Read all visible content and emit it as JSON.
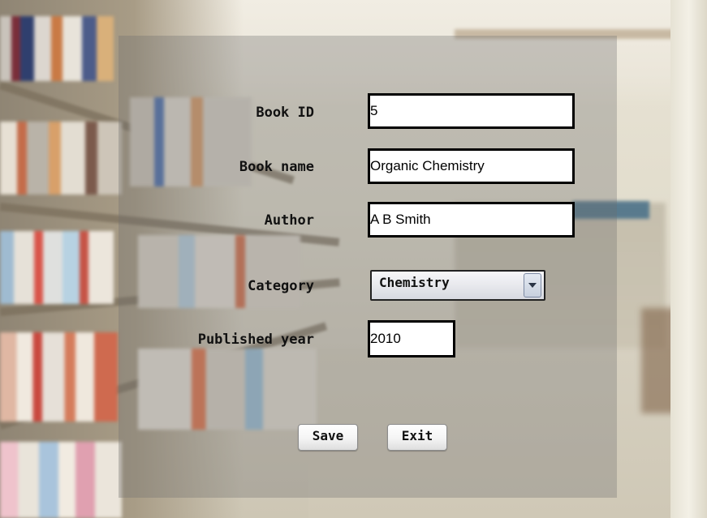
{
  "form": {
    "book_id": {
      "label": "Book ID",
      "value": "5"
    },
    "book_name": {
      "label": "Book name",
      "value": "Organic Chemistry"
    },
    "author": {
      "label": "Author",
      "value": "A B Smith"
    },
    "category": {
      "label": "Category",
      "selected": "Chemistry"
    },
    "published_year": {
      "label": "Published year",
      "value": "2010"
    }
  },
  "buttons": {
    "save": "Save",
    "exit": "Exit"
  },
  "icons": {
    "dropdown": "chevron-down-icon"
  },
  "colors": {
    "panel_overlay": "#6e6e6e",
    "field_border": "#000000",
    "field_background": "#ffffff",
    "label_text": "#111111"
  }
}
